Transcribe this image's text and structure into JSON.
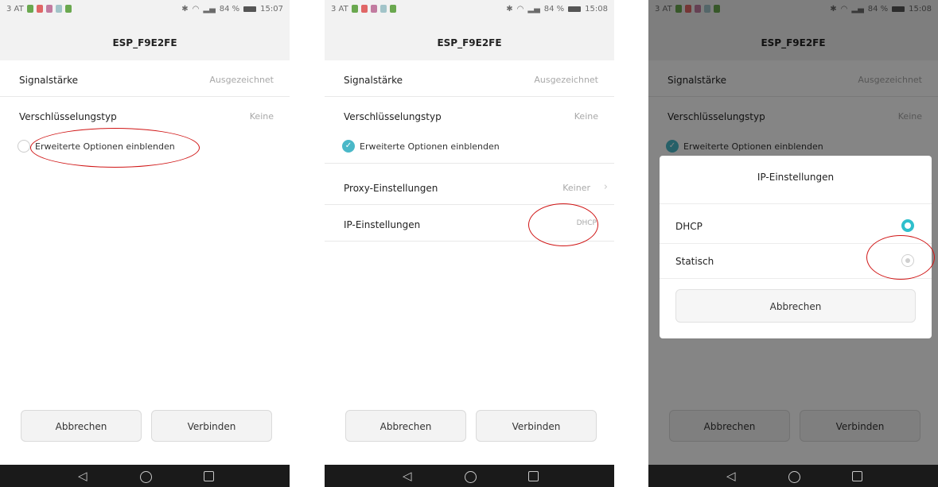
{
  "status_bar": {
    "carrier": "3 AT",
    "battery": "84 %",
    "screens": [
      {
        "time": "15:07"
      },
      {
        "time": "15:08"
      },
      {
        "time": "15:08"
      }
    ],
    "icon_colors": [
      "#6aa84f",
      "#e06666",
      "#c27ba0",
      "#a2c4c9",
      "#6aa84f",
      "#b6d7a8"
    ]
  },
  "network_title": "ESP_F9E2FE",
  "rows": {
    "signal": {
      "label": "Signalstärke",
      "value": "Ausgezeichnet"
    },
    "encryption": {
      "label": "Verschlüsselungstyp",
      "value": "Keine"
    },
    "proxy": {
      "label": "Proxy-Einstellungen",
      "value": "Keiner"
    },
    "ip": {
      "label": "IP-Einstellungen",
      "value": "DHCP"
    }
  },
  "advanced_options": {
    "label": "Erweiterte Optionen einblenden",
    "checked_screen1": false,
    "checked_screen2": true
  },
  "buttons": {
    "cancel": "Abbrechen",
    "connect": "Verbinden"
  },
  "ip_dialog": {
    "title": "IP-Einstellungen",
    "options": [
      {
        "label": "DHCP",
        "selected": true
      },
      {
        "label": "Statisch",
        "selected": false
      }
    ],
    "cancel": "Abbrechen"
  },
  "nav_glyphs": {
    "back": "◁"
  },
  "colors": {
    "accent": "#2fbfcc",
    "highlight_oval": "#d01515"
  }
}
